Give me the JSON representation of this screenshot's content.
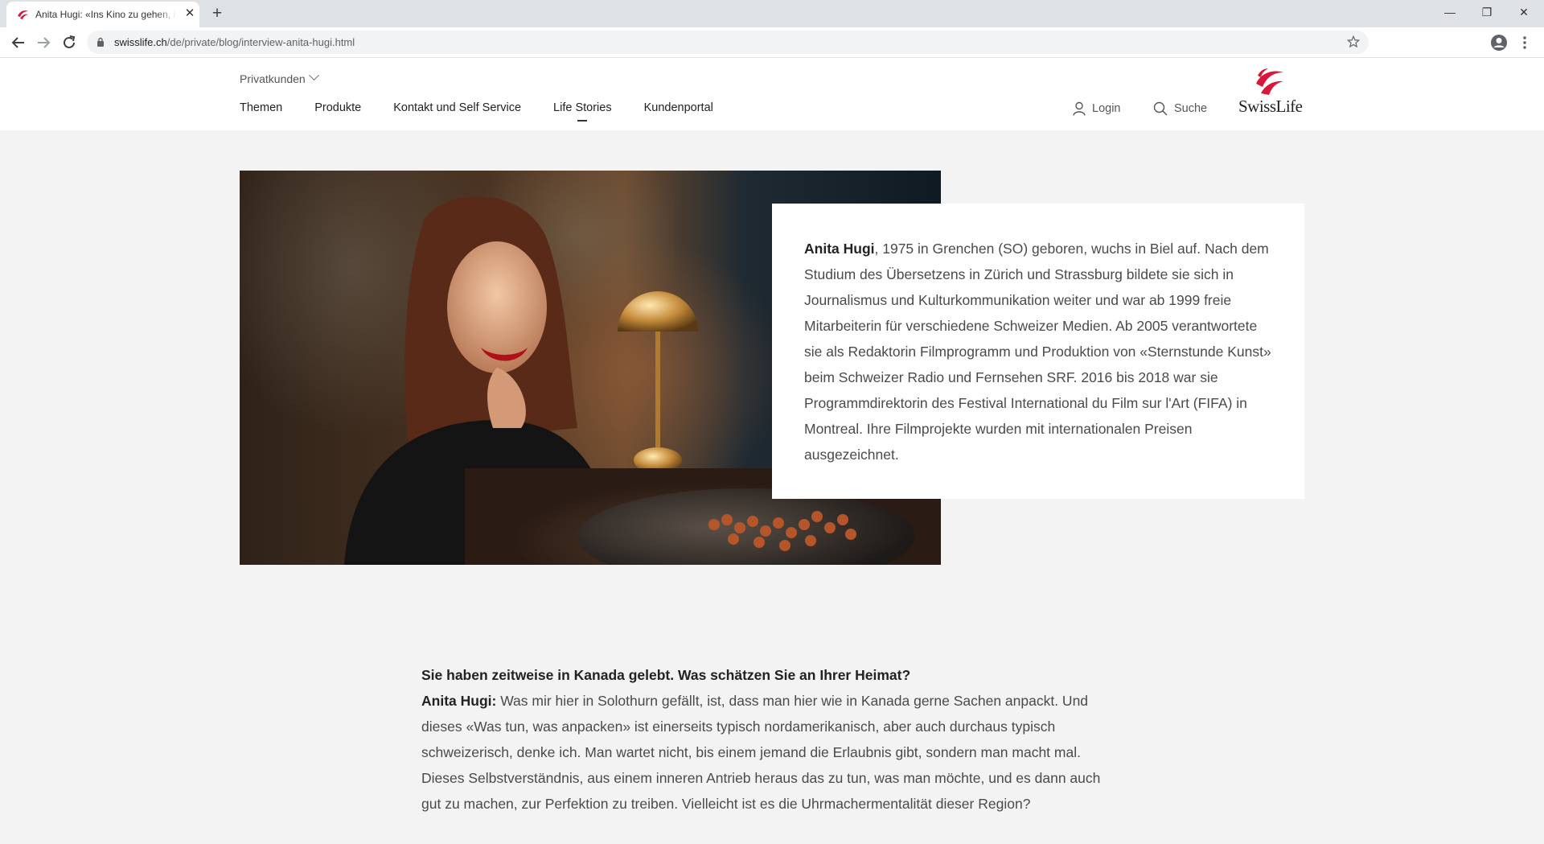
{
  "browser": {
    "tab_title": "Anita Hugi: «Ins Kino zu gehen, ist",
    "tab_close": "✕",
    "new_tab": "+",
    "url_host": "swisslife.ch",
    "url_path": "/de/private/blog/interview-anita-hugi.html",
    "win_min": "—",
    "win_max": "❐",
    "win_close": "✕"
  },
  "header": {
    "segment_label": "Privatkunden",
    "nav": [
      {
        "label": "Themen"
      },
      {
        "label": "Produkte"
      },
      {
        "label": "Kontakt und Self Service"
      },
      {
        "label": "Life Stories"
      },
      {
        "label": "Kundenportal"
      }
    ],
    "active_nav": "Life Stories",
    "login_label": "Login",
    "search_label": "Suche",
    "logo_text": "SwissLife"
  },
  "bio": {
    "name": "Anita Hugi",
    "text": ", 1975 in Grenchen (SO) geboren, wuchs in Biel auf. Nach dem Studium des Übersetzens in Zürich und Strassburg bildete sie sich in Journalismus und Kulturkommunikation weiter und war ab 1999 freie Mitarbeiterin für verschiedene Schweizer Medien. Ab 2005 verantwortete sie als Redaktorin Filmprogramm und Produktion von «Sternstunde Kunst» beim Schweizer Radio und Fernsehen SRF. 2016 bis 2018 war sie Programmdirektorin des Festival International du Film sur l'Art (FIFA) in Montreal. Ihre Filmprojekte wurden mit internationalen Preisen ausgezeichnet."
  },
  "interview": {
    "question": "Sie haben zeitweise in Kanada gelebt. Was schätzen Sie an Ihrer Heimat?",
    "speaker": "Anita Hugi:",
    "answer": " Was mir hier in Solothurn gefällt, ist, dass man hier wie in Kanada gerne Sachen anpackt. Und dieses «Was tun, was anpacken» ist einerseits typisch nordamerikanisch, aber auch durchaus typisch schweizerisch, denke ich. Man wartet nicht, bis einem jemand die Erlaubnis gibt, sondern man macht mal. Dieses Selbstverständnis, aus einem inneren Antrieb heraus das zu tun, was man möchte, und es dann auch gut zu machen, zur Perfektion zu treiben. Vielleicht ist es die Uhrmachermentalität dieser Region?"
  },
  "colors": {
    "brand_red": "#d8183a",
    "page_bg": "#f3f3f3",
    "chrome_bg": "#dee1e6"
  },
  "icons": [
    "swisslife-favicon",
    "close-icon",
    "plus-icon",
    "back-icon",
    "forward-icon",
    "reload-icon",
    "lock-icon",
    "star-icon",
    "profile-icon",
    "menu-icon",
    "chevron-down-icon",
    "user-icon",
    "search-icon"
  ]
}
